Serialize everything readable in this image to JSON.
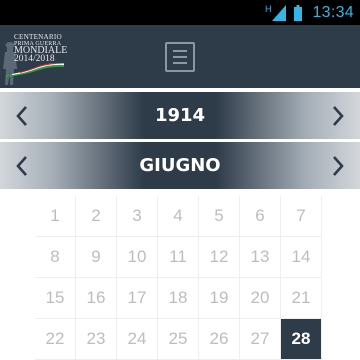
{
  "status_bar": {
    "network_type": "H",
    "time": "13:34",
    "accent_color": "#33b5e5"
  },
  "header": {
    "logo": {
      "line1": "CENTENARIO",
      "line2": "PRIMA GUERRA",
      "line3": "MONDIALE",
      "line4": "2014/2018"
    },
    "menu_icon": "hamburger-menu-icon",
    "background_color": "#2e3b49"
  },
  "year_selector": {
    "value": "1914",
    "prev_icon": "chevron-left-icon",
    "next_icon": "chevron-right-icon"
  },
  "month_selector": {
    "value": "GIUGNO",
    "prev_icon": "chevron-left-icon",
    "next_icon": "chevron-right-icon"
  },
  "calendar": {
    "days": [
      "1",
      "2",
      "3",
      "4",
      "5",
      "6",
      "7",
      "8",
      "9",
      "10",
      "11",
      "12",
      "13",
      "14",
      "15",
      "16",
      "17",
      "18",
      "19",
      "20",
      "21",
      "22",
      "23",
      "24",
      "25",
      "26",
      "27",
      "28"
    ],
    "selected_day": "28",
    "selected_color": "#2e3b49"
  }
}
